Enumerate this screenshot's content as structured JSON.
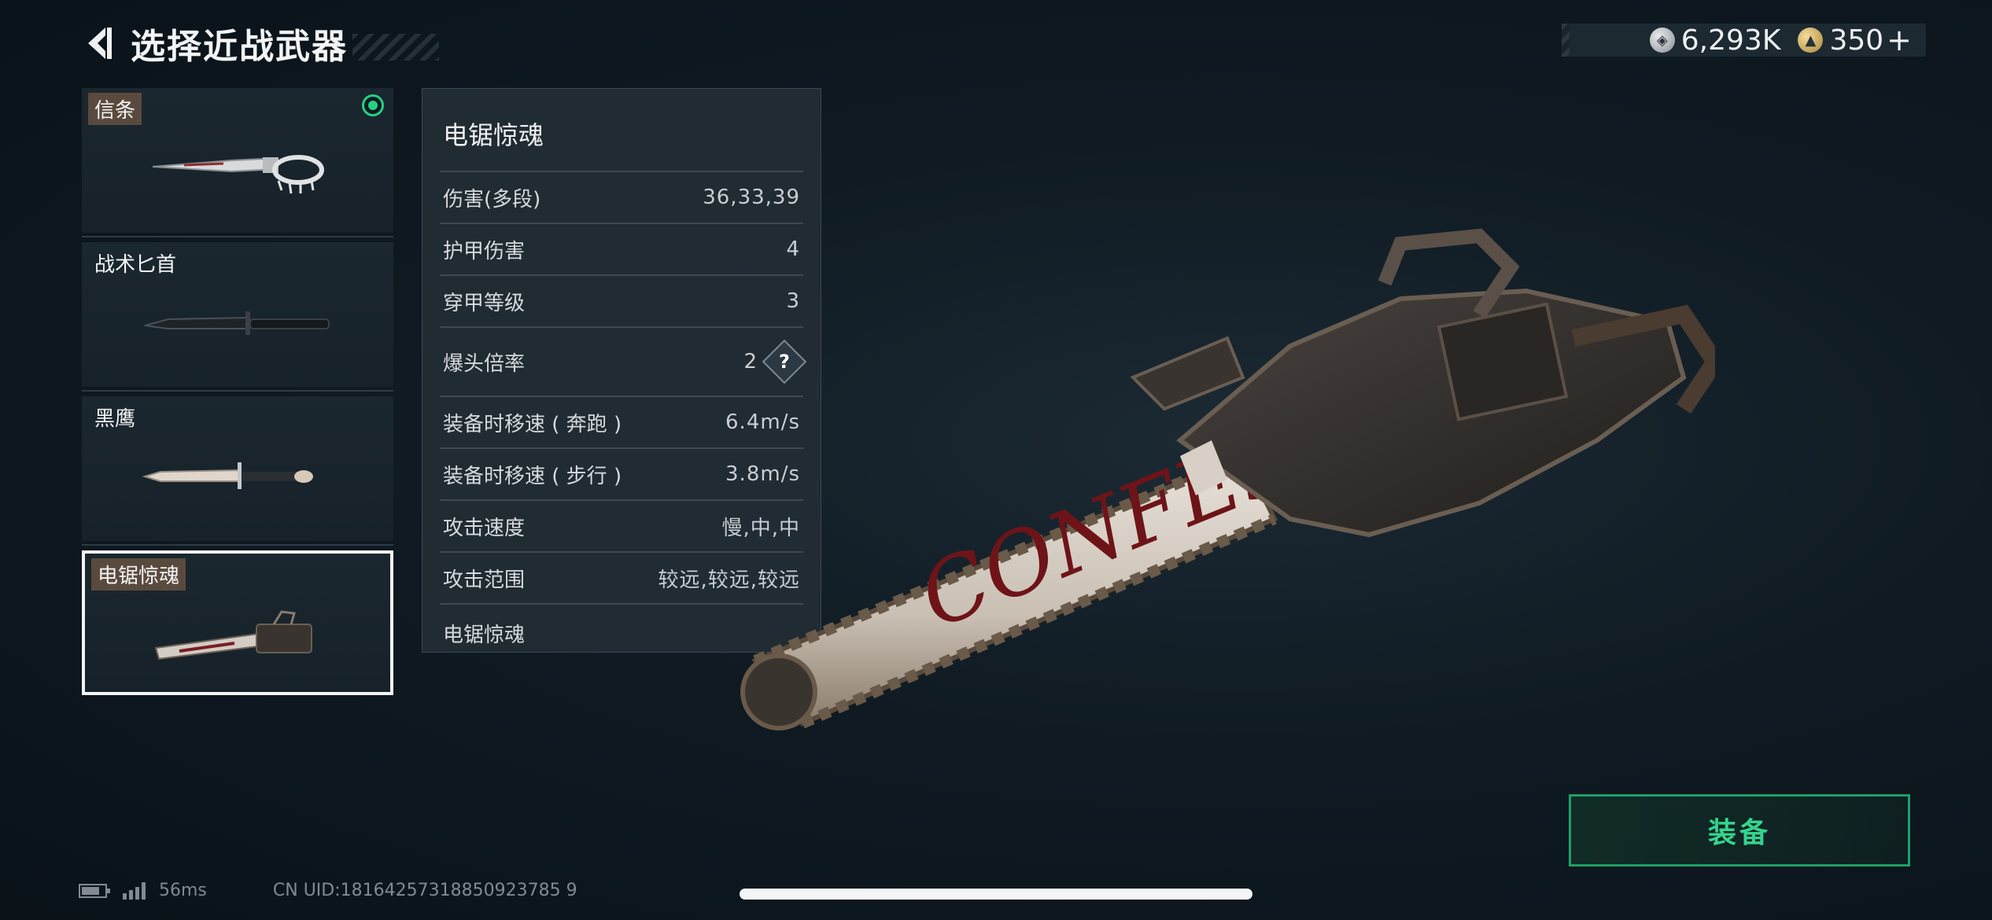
{
  "header": {
    "title": "选择近战武器"
  },
  "currency": [
    {
      "icon": "silver-coin-icon",
      "value": "6,293K"
    },
    {
      "icon": "gold-coin-icon",
      "value": "350"
    }
  ],
  "currency_plus": "+",
  "weapons": [
    {
      "name": "信条",
      "equipped": true
    },
    {
      "name": "战术匕首",
      "equipped": false
    },
    {
      "name": "黑鹰",
      "equipped": false
    },
    {
      "name": "电锯惊魂",
      "equipped": false,
      "selected": true
    }
  ],
  "details": {
    "title": "电锯惊魂",
    "stats": [
      {
        "label": "伤害(多段)",
        "value": "36,33,39"
      },
      {
        "label": "护甲伤害",
        "value": "4"
      },
      {
        "label": "穿甲等级",
        "value": "3"
      },
      {
        "label": "爆头倍率",
        "value": "2",
        "help": "?"
      },
      {
        "label": "装备时移速 ( 奔跑 )",
        "value": "6.4m/s"
      },
      {
        "label": "装备时移速 ( 步行 )",
        "value": "3.8m/s"
      },
      {
        "label": "攻击速度",
        "value": "慢,中,中"
      },
      {
        "label": "攻击范围",
        "value": "较远,较远,较远"
      }
    ],
    "description": "电锯惊魂"
  },
  "chainsaw_text": "CONFESS",
  "equip_button": "装备",
  "status": {
    "ping": "56ms",
    "uid": "CN UID:18164257318850923785 9"
  },
  "colors": {
    "accent_green": "#25d084",
    "equip_border": "#1e9f68"
  }
}
